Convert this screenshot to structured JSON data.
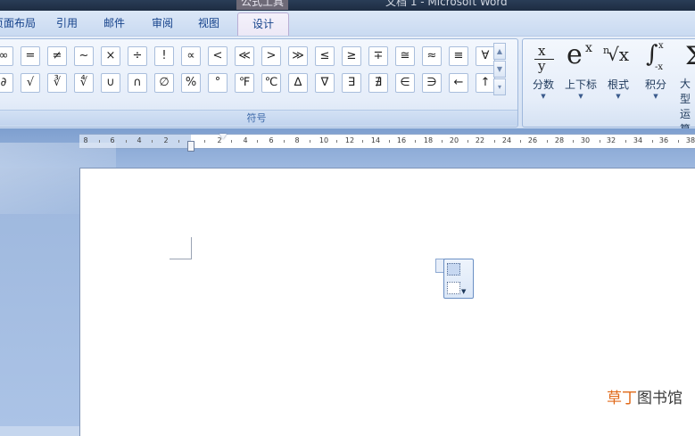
{
  "window": {
    "context_tab_title": "公式工具",
    "document_title": "文档 1 - Microsoft Word"
  },
  "tabs": [
    {
      "label": "页面布局"
    },
    {
      "label": "引用"
    },
    {
      "label": "邮件"
    },
    {
      "label": "审阅"
    },
    {
      "label": "视图"
    }
  ],
  "active_tab": {
    "label": "设计"
  },
  "symbols_group": {
    "label": "符号",
    "row1": [
      "∞",
      "=",
      "≠",
      "~",
      "×",
      "÷",
      "!",
      "∝",
      "<",
      "≪",
      ">",
      "≫",
      "≤",
      "≥",
      "∓",
      "≅",
      "≈",
      "≡",
      "∀"
    ],
    "row2": [
      "∂",
      "√",
      "∛",
      "∜",
      "∪",
      "∩",
      "∅",
      "%",
      "°",
      "℉",
      "℃",
      "∆",
      "∇",
      "∃",
      "∄",
      "∈",
      "∋",
      "←",
      "↑"
    ],
    "scroll_up": "▲",
    "scroll_down": "▼",
    "more": "▾"
  },
  "structures": [
    {
      "label": "分数",
      "icon": "fraction-icon",
      "glyph_top": "x",
      "glyph_bottom": "y"
    },
    {
      "label": "上下标",
      "icon": "script-icon",
      "glyph_base": "e",
      "glyph_sup": "x"
    },
    {
      "label": "根式",
      "icon": "radical-icon",
      "glyph_index": "n",
      "glyph_body": "√x"
    },
    {
      "label": "积分",
      "icon": "integral-icon",
      "glyph_body": "∫",
      "glyph_sup": "x",
      "glyph_sub": "-x"
    },
    {
      "label": "大型运算符",
      "icon": "large-operator-icon",
      "glyph_body": "Σ"
    }
  ],
  "ruler": {
    "numbers": [
      "8",
      "6",
      "4",
      "2",
      "2",
      "4",
      "6",
      "8",
      "10",
      "12",
      "14",
      "16",
      "18",
      "20",
      "22",
      "24",
      "26",
      "28",
      "30",
      "32",
      "34",
      "36",
      "38"
    ]
  },
  "watermark": {
    "part_a": "草丁",
    "part_b": "图书馆"
  }
}
